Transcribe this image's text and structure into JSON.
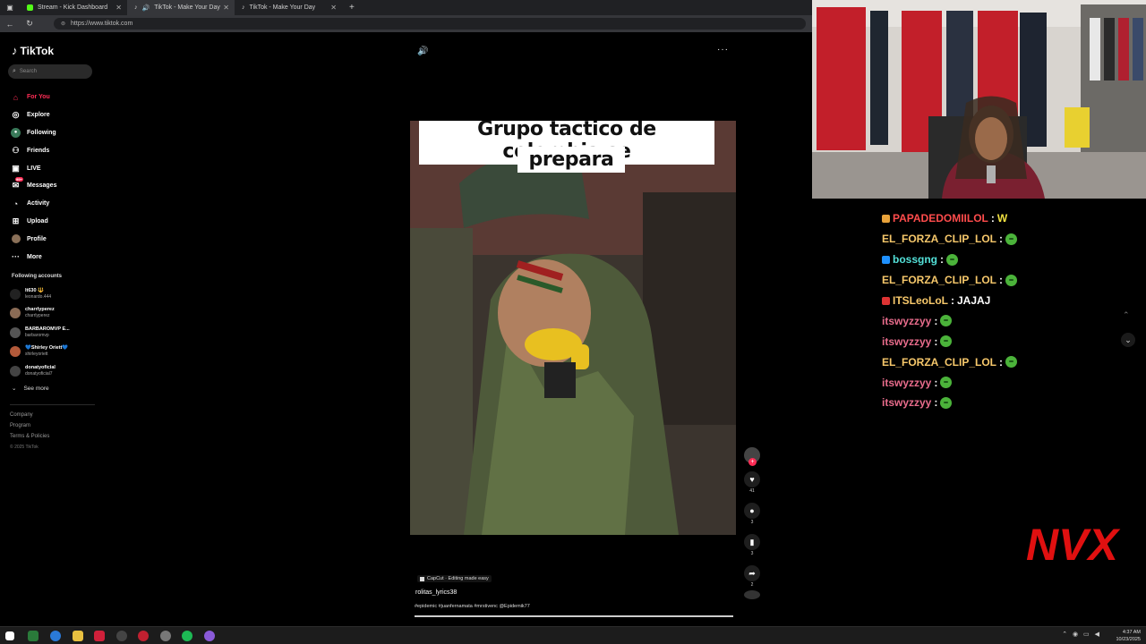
{
  "browser": {
    "tabs": [
      {
        "title": "Stream - Kick Dashboard",
        "favicon_color": "#53fc18"
      },
      {
        "title": "TikTok - Make Your Day",
        "favicon_color": "#ffffff"
      },
      {
        "title": "TikTok - Make Your Day",
        "favicon_color": "#ffffff"
      }
    ],
    "url": "https://www.tiktok.com"
  },
  "tiktok": {
    "logo": "TikTok",
    "search_placeholder": "Search",
    "nav": [
      {
        "label": "For You",
        "icon": "home-icon",
        "active": true
      },
      {
        "label": "Explore",
        "icon": "compass-icon"
      },
      {
        "label": "Following",
        "icon": "following-icon"
      },
      {
        "label": "Friends",
        "icon": "friends-icon"
      },
      {
        "label": "LIVE",
        "icon": "live-icon"
      },
      {
        "label": "Messages",
        "icon": "messages-icon",
        "badge": "99+"
      },
      {
        "label": "Activity",
        "icon": "activity-icon"
      },
      {
        "label": "Upload",
        "icon": "upload-icon"
      },
      {
        "label": "Profile",
        "icon": "profile-icon"
      },
      {
        "label": "More",
        "icon": "more-icon"
      }
    ],
    "following_title": "Following accounts",
    "following": [
      {
        "name": "lt630 🔱",
        "handle": "leonardo.444"
      },
      {
        "name": "charrlyperez",
        "handle": "charrlyperez"
      },
      {
        "name": "BARBAROMVP E...",
        "handle": "barbaromvp"
      },
      {
        "name": "💙Shirley Oriett💙",
        "handle": "shirleyoriett"
      },
      {
        "name": "donatyoficial",
        "handle": "donatyoficial7"
      }
    ],
    "see_more": "See more",
    "footer": [
      "Company",
      "Program",
      "Terms & Policies"
    ],
    "copyright": "© 2025 TikTok",
    "video": {
      "caption_line1": "Grupo tactico de colombia se",
      "caption_line2": "prepara",
      "capcut_tag": "CapCut · Editing made easy",
      "author": "rolitas_lyrics38",
      "hashtags": "#epidemic #juanfernamata #mrstivenc @Epidemik77",
      "progress": 1.0
    },
    "actions": [
      {
        "icon": "heart-icon",
        "count": "41"
      },
      {
        "icon": "comment-icon",
        "count": "3"
      },
      {
        "icon": "bookmark-icon",
        "count": "3"
      },
      {
        "icon": "share-icon",
        "count": "2"
      }
    ]
  },
  "chat": [
    {
      "user": "PAPADEDOMIILOL",
      "color": "#ff4c4c",
      "badge": "#e8a23a",
      "msg": "W"
    },
    {
      "user": "EL_FORZA_CLIP_LOL",
      "color": "#f7c86b",
      "msg": ""
    },
    {
      "user": "bossgng",
      "color": "#53e0d8",
      "badge": "#1e90ff",
      "msg": ""
    },
    {
      "user": "EL_FORZA_CLIP_LOL",
      "color": "#f7c86b",
      "msg": ""
    },
    {
      "user": "ITSLeoLoL",
      "color": "#f7c86b",
      "badge": "#d33",
      "msg": "JAJAJ"
    },
    {
      "user": "itswyzzyy",
      "color": "#e86c8c",
      "msg": ""
    },
    {
      "user": "itswyzzyy",
      "color": "#e86c8c",
      "msg": ""
    },
    {
      "user": "EL_FORZA_CLIP_LOL",
      "color": "#f7c86b",
      "msg": ""
    },
    {
      "user": "itswyzzyy",
      "color": "#e86c8c",
      "msg": ""
    },
    {
      "user": "itswyzzyy",
      "color": "#e86c8c",
      "msg": ""
    }
  ],
  "overlay_logo": "NVX",
  "taskbar": {
    "time": "4:37 AM",
    "date": "10/23/2025"
  }
}
